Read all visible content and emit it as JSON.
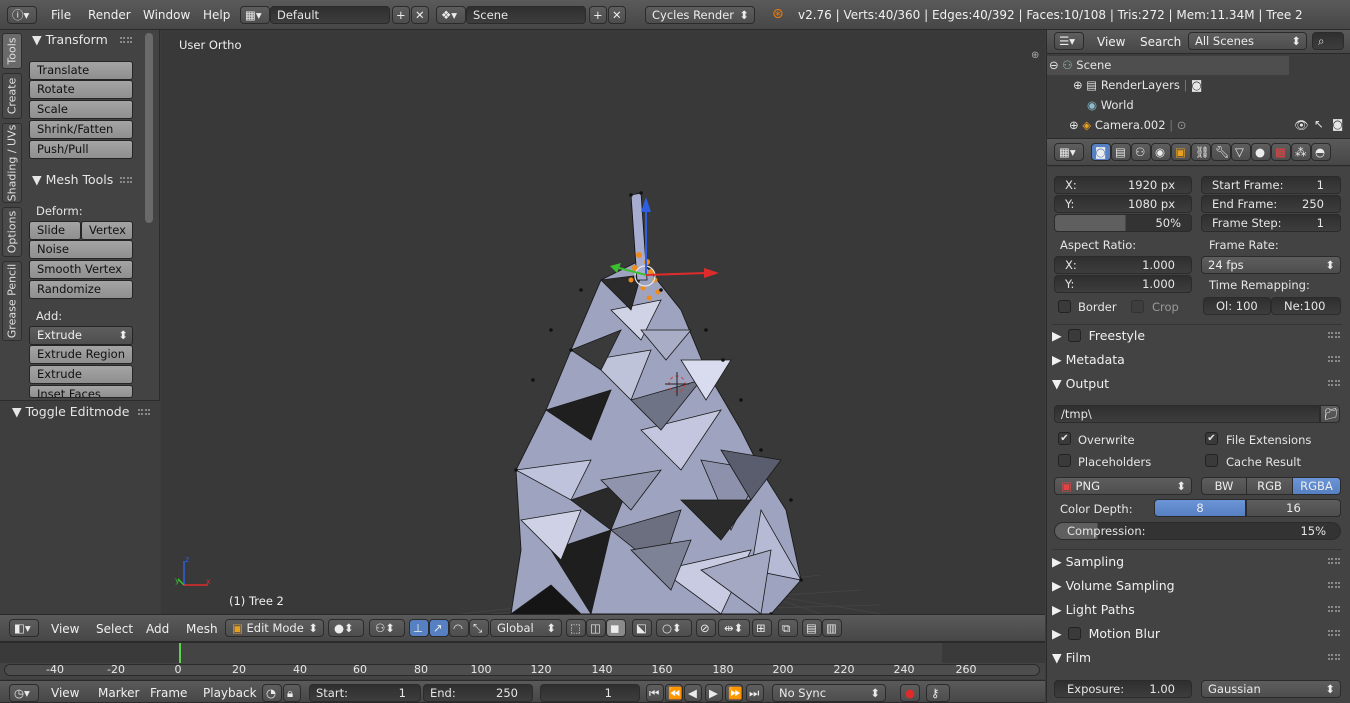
{
  "topbar": {
    "menus": [
      "File",
      "Render",
      "Window",
      "Help"
    ],
    "screen": "Default",
    "scene": "Scene",
    "engine": "Cycles Render",
    "stats": "v2.76 | Verts:40/360 | Edges:40/392 | Faces:10/108 | Tris:272 | Mem:11.34M | Tree 2"
  },
  "toolshelf": {
    "tabs": [
      "Tools",
      "Create",
      "Shading / UVs",
      "Options",
      "Grease Pencil"
    ],
    "transform_title": "Transform",
    "transform": [
      "Translate",
      "Rotate",
      "Scale",
      "Shrink/Fatten",
      "Push/Pull"
    ],
    "mesh_title": "Mesh Tools",
    "deform_label": "Deform:",
    "slide_edge": "Slide Ed",
    "vertex": "Vertex",
    "deform": [
      "Noise",
      "Smooth Vertex",
      "Randomize"
    ],
    "add_label": "Add:",
    "extrude": "Extrude",
    "add": [
      "Extrude Region",
      "Extrude Individual",
      "Inset Faces"
    ],
    "operator": "Toggle Editmode"
  },
  "viewport": {
    "view_name": "User Ortho",
    "object_label": "(1) Tree 2"
  },
  "view3d_header": {
    "menus": [
      "View",
      "Select",
      "Add",
      "Mesh"
    ],
    "mode": "Edit Mode",
    "orientation": "Global"
  },
  "timeline": {
    "ticks": [
      "-40",
      "-20",
      "0",
      "20",
      "40",
      "60",
      "80",
      "100",
      "120",
      "140",
      "160",
      "180",
      "200",
      "220",
      "240",
      "260"
    ],
    "menus": [
      "View",
      "Marker",
      "Frame",
      "Playback"
    ],
    "start_label": "Start:",
    "start": "1",
    "end_label": "End:",
    "end": "250",
    "current": "1",
    "sync": "No Sync"
  },
  "outliner": {
    "menus": [
      "View",
      "Search"
    ],
    "filter": "All Scenes",
    "items": [
      "Scene",
      "RenderLayers",
      "World",
      "Camera.002"
    ]
  },
  "props": {
    "res_x_label": "X:",
    "res_x": "1920 px",
    "res_y_label": "Y:",
    "res_y": "1080 px",
    "res_pct": "50%",
    "start_frame_label": "Start Frame:",
    "start_frame": "1",
    "end_frame_label": "End Frame:",
    "end_frame": "250",
    "frame_step_label": "Frame Step:",
    "frame_step": "1",
    "aspect_label": "Aspect Ratio:",
    "asp_x_label": "X:",
    "asp_x": "1.000",
    "asp_y_label": "Y:",
    "asp_y": "1.000",
    "framerate_label": "Frame Rate:",
    "framerate": "24 fps",
    "time_remap_label": "Time Remapping:",
    "old": "Ol: 100",
    "new": "Ne:100",
    "border": "Border",
    "crop": "Crop",
    "freestyle": "Freestyle",
    "metadata": "Metadata",
    "output": "Output",
    "path": "/tmp\\",
    "overwrite": "Overwrite",
    "file_ext": "File Extensions",
    "placeholders": "Placeholders",
    "cache": "Cache Result",
    "format": "PNG",
    "bw": "BW",
    "rgb": "RGB",
    "rgba": "RGBA",
    "depth_label": "Color Depth:",
    "depth8": "8",
    "depth16": "16",
    "compression_label": "Compression:",
    "compression": "15%",
    "sampling": "Sampling",
    "volume": "Volume Sampling",
    "lightpaths": "Light Paths",
    "motionblur": "Motion Blur",
    "film": "Film",
    "exposure_label": "Exposure:",
    "exposure": "1.00",
    "filter": "Gaussian"
  }
}
